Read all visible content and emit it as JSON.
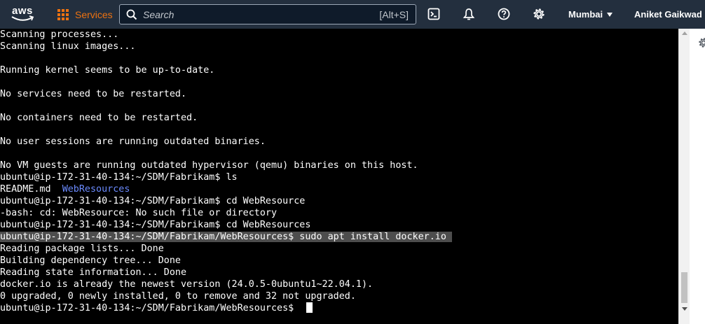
{
  "topbar": {
    "logo_text": "aws",
    "services_label": "Services",
    "search": {
      "placeholder": "Search",
      "value": "",
      "shortcut": "[Alt+S]"
    },
    "icons": [
      "cloudshell-icon",
      "bell-icon",
      "help-icon",
      "gear-icon"
    ],
    "region": "Mumbai",
    "user": "Aniket Gaikwad"
  },
  "terminal": {
    "lines": [
      "Scanning processes...",
      "Scanning linux images...",
      "",
      "Running kernel seems to be up-to-date.",
      "",
      "No services need to be restarted.",
      "",
      "No containers need to be restarted.",
      "",
      "No user sessions are running outdated binaries.",
      "",
      "No VM guests are running outdated hypervisor (qemu) binaries on this host.",
      "ubuntu@ip-172-31-40-134:~/SDM/Fabrikam$ ls",
      "README.md  ",
      "ubuntu@ip-172-31-40-134:~/SDM/Fabrikam$ cd WebResource",
      "-bash: cd: WebResource: No such file or directory",
      "ubuntu@ip-172-31-40-134:~/SDM/Fabrikam$ cd WebResources",
      "ubuntu@ip-172-31-40-134:~/SDM/Fabrikam/WebResources$ sudo apt install docker.io",
      "Reading package lists... Done",
      "Building dependency tree... Done",
      "Reading state information... Done",
      "docker.io is already the newest version (24.0.5-0ubuntu1~22.04.1).",
      "0 upgraded, 0 newly installed, 0 to remove and 32 not upgraded.",
      "ubuntu@ip-172-31-40-134:~/SDM/Fabrikam/WebResources$ "
    ],
    "dir_entry": "WebResources",
    "dir_color": "#6b8bff",
    "highlight_color": "#4d4d4d"
  },
  "colors": {
    "topbar_bg": "#232f3e",
    "services_accent": "#ec7211",
    "terminal_bg": "#000000",
    "terminal_fg": "#ffffff"
  }
}
